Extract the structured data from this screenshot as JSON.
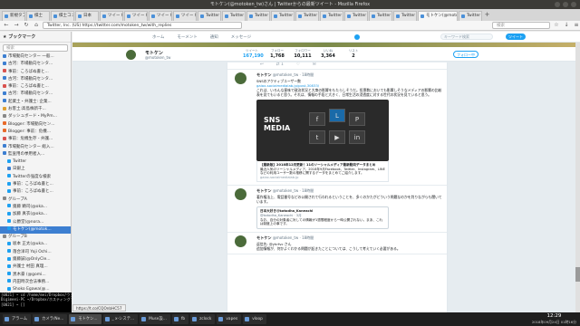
{
  "window": {
    "title": "モトケン(@motoken_tw)さん | Twitterからの最新ツイート - Mozilla Firefox"
  },
  "tabs": [
    {
      "label": "新規タブ"
    },
    {
      "label": "棋士"
    },
    {
      "label": "棋士コンピ"
    },
    {
      "label": "日本"
    },
    {
      "label": "ツイート"
    },
    {
      "label": "ツイート"
    },
    {
      "label": "ツイート"
    },
    {
      "label": "ツイート"
    },
    {
      "label": "Twitter"
    },
    {
      "label": "Twitter"
    },
    {
      "label": "Twitter"
    },
    {
      "label": "Twitter"
    },
    {
      "label": "Twitter"
    },
    {
      "label": "Twitter"
    },
    {
      "label": "Twitter"
    },
    {
      "label": "Twitter"
    },
    {
      "label": "Twitter"
    },
    {
      "label": "モトケン"
    },
    {
      "label": "Twitter"
    },
    {
      "label": "Twitter"
    }
  ],
  "active_tab": "モトケン(@motoken_tw)",
  "navbar": {
    "url": "Twitter, Inc. (US)   https://twitter.com/motoken_tw/with_replies",
    "search_placeholder": "検索"
  },
  "sidebar": {
    "title": "ブックマーク",
    "search_placeholder": "検索",
    "items": [
      {
        "label": "市場動向センター 一般...",
        "color": "#3d7fd1"
      },
      {
        "label": "古河：市場動向センタ...",
        "color": "#3d7fd1"
      },
      {
        "label": "事前：ころばぬ書と...",
        "color": "#d9534f"
      },
      {
        "label": "古河：市場動向センタ...",
        "color": "#3d7fd1"
      },
      {
        "label": "事前：ころばぬ書と...",
        "color": "#d9534f"
      },
      {
        "label": "古河：市場動向センタ...",
        "color": "#3d7fd1"
      },
      {
        "label": "起業土・弁護士: 企業...",
        "color": "#3d7fd1"
      },
      {
        "label": "お客土:高島株新千...",
        "color": "#e0a030"
      },
      {
        "label": "ダッシュボード・MyPm...",
        "color": "#888888"
      },
      {
        "label": "Blogger: 市場動向セン...",
        "color": "#e86a2a"
      },
      {
        "label": "Blogger: 事前：危機...",
        "color": "#e86a2a"
      },
      {
        "label": "事前：危機生存 - 弁護...",
        "color": "#d9534f"
      },
      {
        "label": "市場動向センター 総入...",
        "color": "#3d7fd1"
      },
      {
        "label": "監査用の挙用者入...",
        "color": "#3d7fd1"
      },
      {
        "label": "Twitter",
        "color": "#1da1f2"
      },
      {
        "label": "日銀上",
        "color": "#3d7fd1"
      },
      {
        "label": "Twitterの強度な検索",
        "color": "#1da1f2"
      },
      {
        "label": "事前：ころばぬ書と...",
        "color": "#1da1f2"
      },
      {
        "label": "事前：ころばぬ書と...",
        "color": "#1da1f2"
      },
      {
        "label": "グループA",
        "color": "#888888"
      },
      {
        "label": "齋藤 顕司(@oka...",
        "color": "#1da1f2"
      },
      {
        "label": "加藤 真衣(@oka...",
        "color": "#1da1f2"
      },
      {
        "label": "公爵堂(@nora...",
        "color": "#1da1f2"
      },
      {
        "label": "モトケン(@motok...",
        "color": "#1da1f2",
        "selected": true
      },
      {
        "label": "グループB",
        "color": "#888888"
      },
      {
        "label": "坂本 正太(@uka...",
        "color": "#1da1f2"
      },
      {
        "label": "落合洋司 Yoji Ochi...",
        "color": "#1da1f2"
      },
      {
        "label": "齋藤誠(@OnlyCle...",
        "color": "#1da1f2"
      },
      {
        "label": "弁護士 村田 真理...",
        "color": "#1da1f2"
      },
      {
        "label": "黒木豪 (@gomi...",
        "color": "#1da1f2"
      },
      {
        "label": "内田時次合法事務...",
        "color": "#1da1f2"
      },
      {
        "label": "Shoko Egawa(@...",
        "color": "#1da1f2"
      },
      {
        "label": "渡部(仮)(@Koko...",
        "color": "#1da1f2"
      },
      {
        "label": "サイロ(@vrossoa...",
        "color": "#1da1f2"
      },
      {
        "label": "弁護士 紀藤正樹...",
        "color": "#1da1f2"
      },
      {
        "label": "弁護士 ひろゆき(...",
        "color": "#1da1f2"
      }
    ]
  },
  "terminal": {
    "lines": [
      "[0021] ~ cd /home/mei/Dropbox/ウェブアップロード",
      "Digimeei-PC ~/Dropbox/ホスティングブロード",
      "[0021] ~ []"
    ]
  },
  "twitter": {
    "nav": [
      "ホーム",
      "モーメント",
      "通知",
      "メッセージ"
    ],
    "search_placeholder": "キーワード検索",
    "tweet_button": "ツイート",
    "profile": {
      "name": "モトケン",
      "handle": "@motoken_tw"
    },
    "stats": [
      {
        "label": "ツイート",
        "value": "167,190"
      },
      {
        "label": "フォロー",
        "value": "1,768"
      },
      {
        "label": "フォロワー",
        "value": "10,111"
      },
      {
        "label": "いいね",
        "value": "3,364"
      },
      {
        "label": "リスト",
        "value": "2"
      }
    ],
    "follow_button": "フォロー中",
    "actions": {
      "reply": "",
      "retweet": "1",
      "like": ""
    },
    "tweet1": {
      "name": "モトケン",
      "handle": "@motoken_tw · 18時間",
      "line1": "SNSのアクティブユーザー数",
      "link": "gaiax-socialmedialab.jp/post-30833/",
      "body": "これは、いろんな意味で政治状況と大衆の影響をもたらしそうだ。投票数においても影響しそうなメディアの影響の比較表を見てもいると思う。それは、情報の手段と大きく、日常生活の浸透度に対する世代の状況を見ていると思う。",
      "media_title": "SNS\nMEDIA",
      "card_title": "【最新版】2018年12月更新！11のソーシャルメディア最新動向データまとめ",
      "card_desc": "最近人気のソーシャルメディア。2018年9月Facebook、Twitter、Instagram、LINEなどの利用ユーザー数の推移に関するデータをまとめてご紹介します。",
      "card_url": "gaiax-socialmedialab.jp"
    },
    "tweet2": {
      "name": "モトケン",
      "handle": "@motoken_tw · 18時間",
      "body": "著作権法上、電話番号などの公開されて行われるということを、多くのかたがどういう問題なのかを判りながらも聞いています。",
      "quote_name": "日本大好き@kotodha_Kaneachi",
      "quote_handle": "@kotodha_Kaneachi · 3月",
      "quote_body": "なお、自分の対象者に対しての情報が1週間程度から一時公開されない。まあ、これは制度上の事です。"
    },
    "tweet3": {
      "name": "モトケン",
      "handle": "@motoken_tw · 18時間",
      "body": "返信先: @yhrfvc さん\n追加情報が、何かよくわかる問題が起きたことについては、こうして考えていく必要がある。"
    }
  },
  "status_url": "https://t.co/CQOnbHC57",
  "taskbar": {
    "items": [
      "アラーム",
      "カメラ/Ne...",
      "モトケン...",
      "_ x-システ...",
      "Muse設...",
      "fb",
      "zclock",
      "vapes",
      "vloop"
    ],
    "time": "12:29",
    "date": "2018年09月24日 01時16分"
  }
}
